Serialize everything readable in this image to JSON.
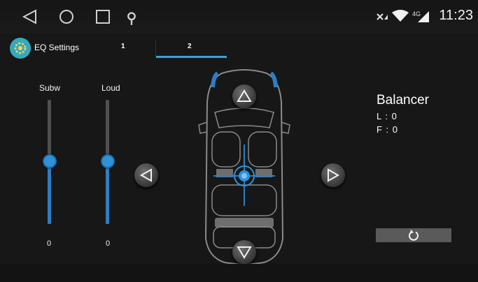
{
  "app": {
    "title": "EQ Settings",
    "tabs": [
      {
        "label": "1",
        "active": false
      },
      {
        "label": "2",
        "active": true
      }
    ]
  },
  "status": {
    "time": "11:23",
    "network_type": "4G",
    "icons": [
      "no-signal-x-icon",
      "wifi-icon",
      "cellular-signal-icon"
    ]
  },
  "navigation": {
    "icons": [
      "back-triangle-icon",
      "home-circle-icon",
      "recent-apps-square-icon",
      "location-pin-icon"
    ]
  },
  "sliders": [
    {
      "label": "Subw",
      "value": "0",
      "level": 0.52
    },
    {
      "label": "Loud",
      "value": "0",
      "level": 0.52
    }
  ],
  "balancer": {
    "title": "Balancer",
    "lines": [
      "L :  0",
      "F :  0"
    ]
  },
  "colors": {
    "accent": "#2f92d9",
    "tab_underline": "#3aa3dd",
    "logo": "#35a9bd",
    "background": "#171717"
  },
  "icons": {
    "logo": "settings-gear-icon",
    "up": "arrow-up-icon",
    "down": "arrow-down-icon",
    "left": "arrow-left-icon",
    "right": "arrow-right-icon",
    "reset": "refresh-icon",
    "car": "car-top-view-icon",
    "crosshair": "balance-point-icon"
  }
}
